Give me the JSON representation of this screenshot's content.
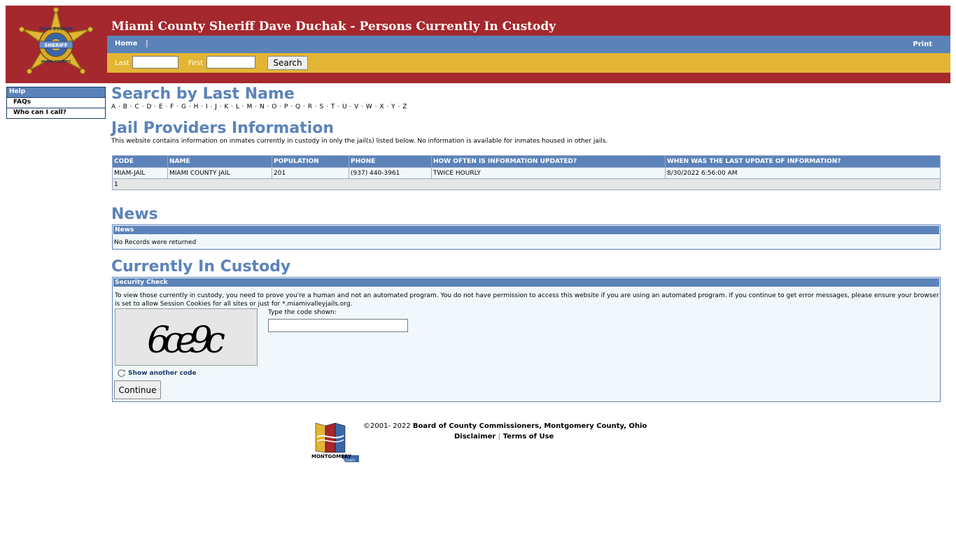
{
  "header": {
    "title": "Miami County Sheriff Dave Duchak - Persons Currently In Custody",
    "nav": {
      "home": "Home",
      "separator": "|",
      "print": "Print"
    },
    "search": {
      "last_label": "Last",
      "first_label": "First",
      "button": "Search"
    }
  },
  "sidebar": {
    "heading": "Help",
    "items": [
      {
        "label": "FAQs"
      },
      {
        "label": "Who can I call?"
      }
    ]
  },
  "search_by_last": {
    "heading": "Search by Last Name",
    "letters": [
      "A",
      "B",
      "C",
      "D",
      "E",
      "F",
      "G",
      "H",
      "I",
      "J",
      "K",
      "L",
      "M",
      "N",
      "O",
      "P",
      "Q",
      "R",
      "S",
      "T",
      "U",
      "V",
      "W",
      "X",
      "Y",
      "Z"
    ]
  },
  "providers": {
    "heading": "Jail Providers Information",
    "note": "This website contains information on inmates currently in custody in only the jail(s) listed below. No information is available for inmates housed in other jails.",
    "columns": [
      "CODE",
      "NAME",
      "POPULATION",
      "PHONE",
      "HOW OFTEN IS INFORMATION UPDATED?",
      "WHEN WAS THE LAST UPDATE OF INFORMATION?"
    ],
    "rows": [
      [
        "MIAM-JAIL",
        "MIAMI COUNTY JAIL",
        "201",
        "(937) 440-3961",
        "TWICE HOURLY",
        "8/30/2022 6:56:00 AM"
      ]
    ],
    "pager": "1"
  },
  "news": {
    "heading": "News",
    "panel_title": "News",
    "empty": "No Records were returned"
  },
  "custody": {
    "heading": "Currently In Custody",
    "panel_title": "Security Check",
    "message": "To view those currently in custody, you need to prove you're a human and not an automated program. You do not have permission to access this website if you are using an automated program. If you continue to get error messages, please ensure your browser is set to allow Session Cookies for all sites or just for *.miamivalleyjails.org.",
    "captcha_text": "6ce9c",
    "code_label": "Type the code shown:",
    "another_code": "Show another code",
    "continue_button": "Continue"
  },
  "footer": {
    "copyright": "©2001- 2022",
    "org": "Board of County Commissioners, Montgomery County, Ohio",
    "disclaimer": "Disclaimer",
    "separator": "|",
    "terms": "Terms of Use",
    "logo_text": "MONTGOMERY",
    "logo_subtext": "COUNTY"
  },
  "colors": {
    "header_red": "#a4282d",
    "nav_blue": "#5b83b9",
    "search_gold": "#e3b534",
    "panel_bg": "#f1f8fb"
  },
  "badge_text": {
    "top": "DAVE DUCHAK",
    "center": "SHERIFF",
    "bottom": "MIAMI COUNTY"
  }
}
